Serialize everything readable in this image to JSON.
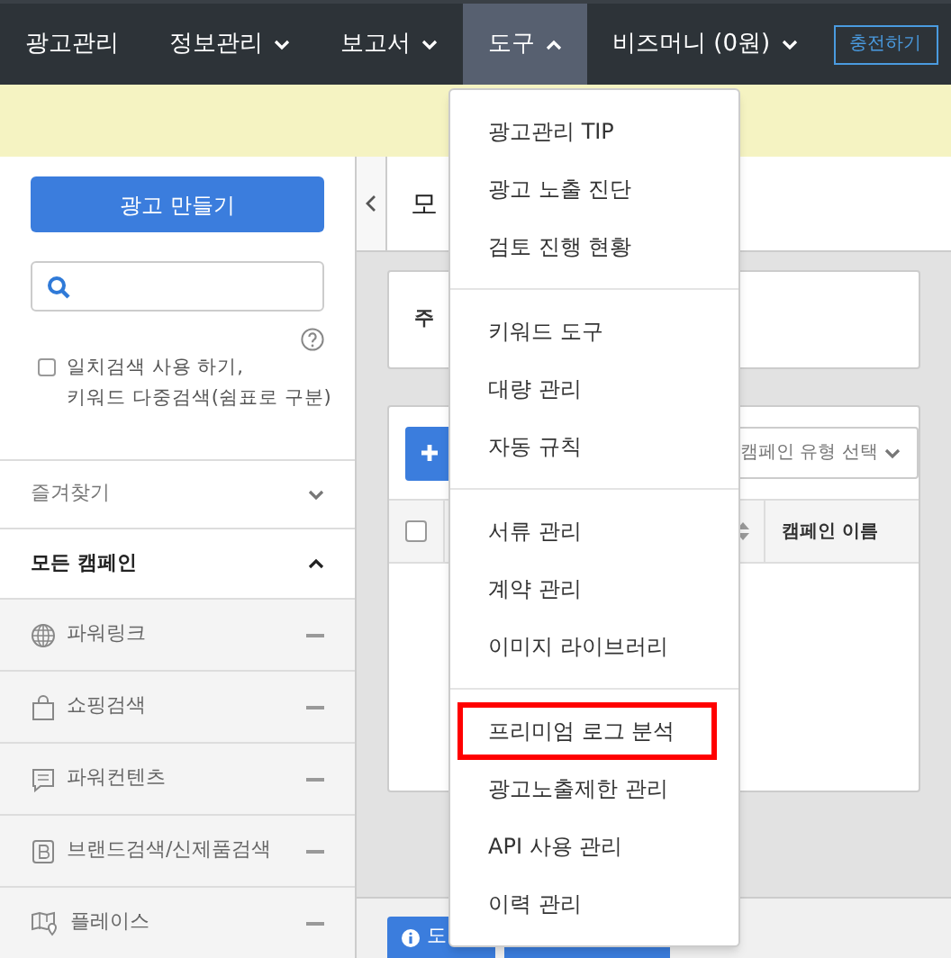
{
  "nav": {
    "items": [
      {
        "label": "광고관리",
        "has_dropdown": false,
        "selected": false
      },
      {
        "label": "정보관리",
        "has_dropdown": true,
        "expanded": false,
        "selected": false
      },
      {
        "label": "보고서",
        "has_dropdown": true,
        "expanded": false,
        "selected": false
      },
      {
        "label": "도구",
        "has_dropdown": true,
        "expanded": true,
        "selected": true
      },
      {
        "label": "비즈머니 (0원)",
        "has_dropdown": true,
        "expanded": false,
        "selected": false
      }
    ],
    "charge_button": "충전하기"
  },
  "sidebar": {
    "create_button": "광고 만들기",
    "exact_match": {
      "lines": [
        "일치검색 사용 하기,",
        "키워드 다중검색(쉼표로 구분)"
      ],
      "checked": false
    },
    "favorites": {
      "label": "즐겨찾기",
      "expanded": false
    },
    "all_campaigns": {
      "label": "모든 캠페인",
      "expanded": true
    },
    "campaign_types": [
      {
        "label": "파워링크",
        "kind": "globe"
      },
      {
        "label": "쇼핑검색",
        "kind": "bag"
      },
      {
        "label": "파워컨텐츠",
        "kind": "chat"
      },
      {
        "label": "브랜드검색/신제품검색",
        "kind": "brand"
      },
      {
        "label": "플레이스",
        "kind": "map"
      }
    ]
  },
  "main": {
    "title": "모",
    "notice": "주",
    "type_select": "캠페인 유형 선택",
    "column_header": "캠페인 이름",
    "select_all_checked": false,
    "help_button": "도"
  },
  "menu": {
    "groups": [
      [
        {
          "label": "광고관리 TIP",
          "highlighted": false
        },
        {
          "label": "광고 노출 진단",
          "highlighted": false
        },
        {
          "label": "검토 진행 현황",
          "highlighted": false
        }
      ],
      [
        {
          "label": "키워드 도구",
          "highlighted": false
        },
        {
          "label": "대량 관리",
          "highlighted": false
        },
        {
          "label": "자동 규칙",
          "highlighted": false
        }
      ],
      [
        {
          "label": "서류 관리",
          "highlighted": false
        },
        {
          "label": "계약 관리",
          "highlighted": false
        },
        {
          "label": "이미지 라이브러리",
          "highlighted": false
        }
      ],
      [
        {
          "label": "프리미엄 로그 분석",
          "highlighted": true
        },
        {
          "label": "광고노출제한 관리",
          "highlighted": false
        },
        {
          "label": "API 사용 관리",
          "highlighted": false
        },
        {
          "label": "이력 관리",
          "highlighted": false
        }
      ]
    ]
  }
}
